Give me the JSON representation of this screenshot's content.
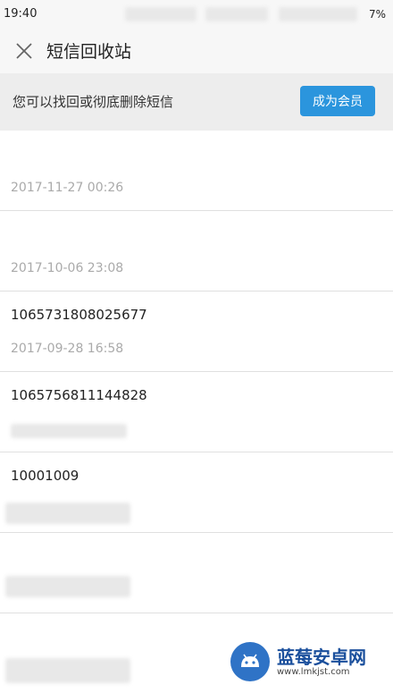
{
  "status_bar": {
    "time": "19:40",
    "battery": "7%"
  },
  "header": {
    "title": "短信回收站"
  },
  "banner": {
    "text": "您可以找回或彻底删除短信",
    "button_label": "成为会员"
  },
  "messages": [
    {
      "sender": "",
      "time": "2017-11-27 00:26"
    },
    {
      "sender": "",
      "time": "2017-10-06 23:08"
    },
    {
      "sender": "1065731808025677",
      "time": "2017-09-28 16:58"
    },
    {
      "sender": "1065756811144828",
      "time": ""
    },
    {
      "sender": "10001009",
      "time": ""
    },
    {
      "sender": "",
      "time": ""
    },
    {
      "sender": "",
      "time": ""
    }
  ],
  "watermark": {
    "name": "蓝莓安卓网",
    "url": "www.lmkjst.com"
  },
  "icons": {
    "close": "close-icon"
  }
}
